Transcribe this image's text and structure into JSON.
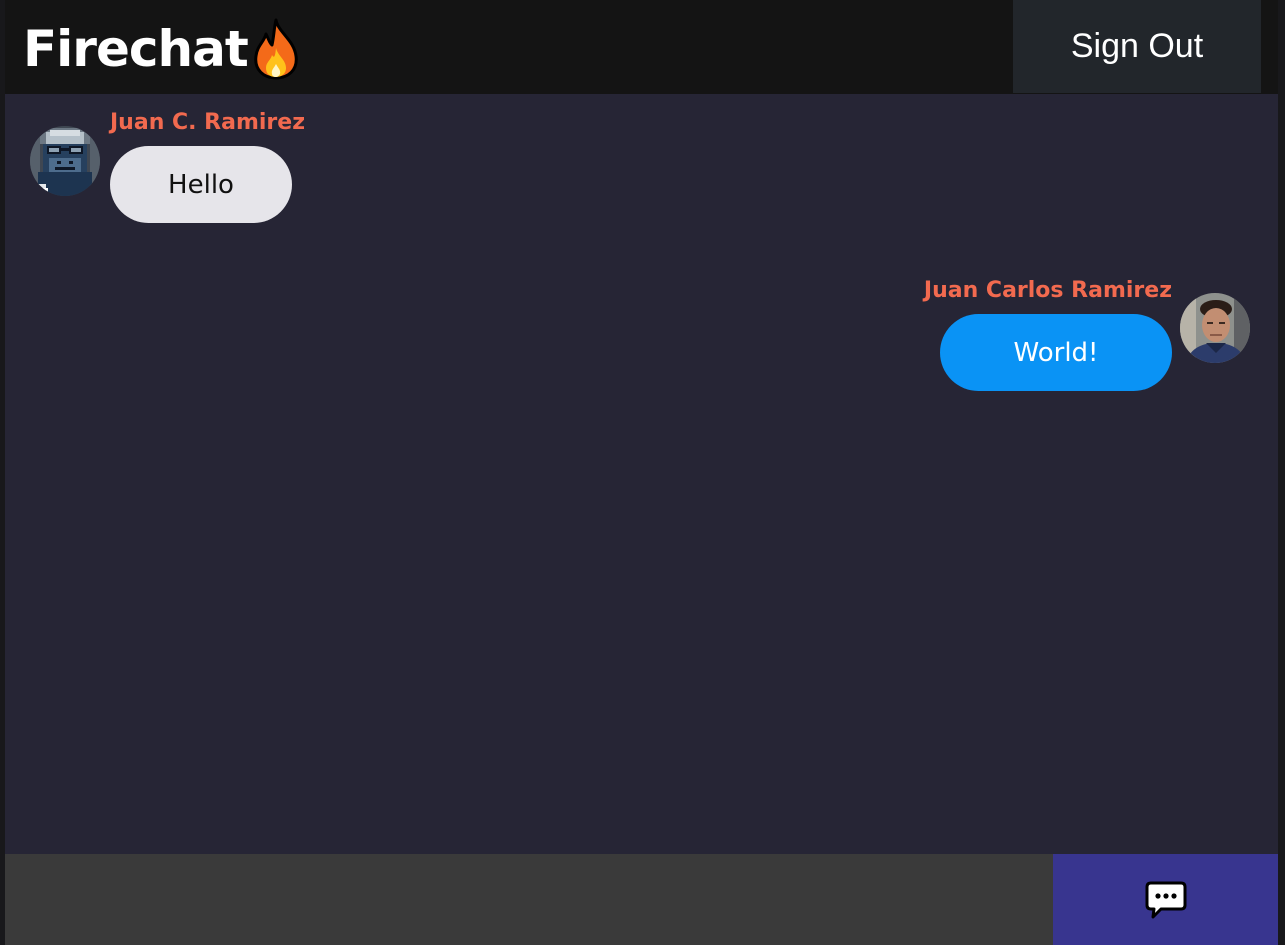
{
  "header": {
    "title": "Firechat",
    "title_icon": "fire-icon",
    "sign_out_label": "Sign Out"
  },
  "messages": [
    {
      "author": "Juan C. Ramirez",
      "text": "Hello",
      "side": "received",
      "avatar": "pixel-gorilla-avatar",
      "bubble_color": "#e6e5ea"
    },
    {
      "author": "Juan Carlos Ramirez",
      "text": "World!",
      "side": "sent",
      "avatar": "photo-avatar",
      "bubble_color": "#0a93f5"
    }
  ],
  "composer": {
    "value": "",
    "placeholder": "",
    "send_icon": "speech-bubble-icon"
  },
  "colors": {
    "author_name": "#f26a4f",
    "background": "#262535",
    "header": "#141414",
    "send_button": "#38358f"
  }
}
